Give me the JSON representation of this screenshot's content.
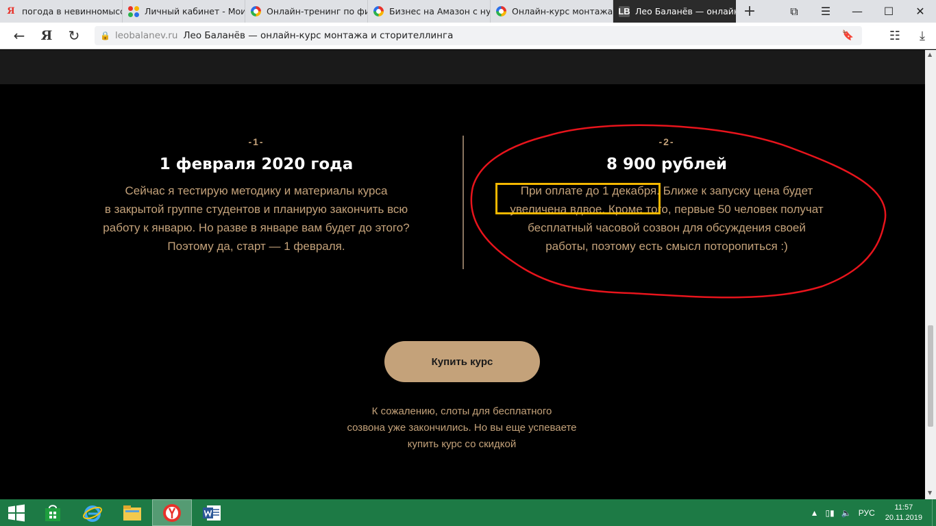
{
  "browser": {
    "tabs": [
      {
        "title": "погода в невинномысс",
        "icon": "yandex-icon",
        "active": false
      },
      {
        "title": "Личный кабинет - Мои",
        "icon": "grid-icon",
        "active": false
      },
      {
        "title": "Онлайн-тренинг по фи",
        "icon": "ring-icon",
        "active": false
      },
      {
        "title": "Бизнес на Амазон с ну",
        "icon": "ring-icon",
        "active": false
      },
      {
        "title": "Онлайн-курс монтажа",
        "icon": "ring-icon",
        "active": false
      },
      {
        "title": "Лео Баланёв — онлайн",
        "icon": "lb-icon",
        "active": true
      }
    ],
    "favicon_lb": "LB",
    "favicon_ya": "Я",
    "new_tab": "+",
    "address": {
      "domain": "leobalanev.ru",
      "title": "Лео Баланёв — онлайн-курс монтажа и сторителлинга"
    },
    "ya_button": "Я"
  },
  "content": {
    "step1": {
      "number": "-1-",
      "heading": "1 февраля 2020 года",
      "lines": [
        "Сейчас я тестирую методику и материалы курса",
        "в закрытой группе студентов и планирую закончить всю",
        "работу к январю. Но разве в январе вам будет до этого?",
        "Поэтому да, старт — 1 февраля."
      ]
    },
    "step2": {
      "number": "-2-",
      "heading": "8 900 рублей",
      "lines": [
        "При оплате до 1 декабря. Ближе к запуску цена будет",
        "увеличена вдвое. Кроме того, первые 50 человек получат",
        "бесплатный часовой созвон для обсуждения своей",
        "работы, поэтому есть смысл поторопиться :)"
      ]
    },
    "buy_button": "Купить курс",
    "note_lines": [
      "К сожалению, слоты для бесплатного",
      "созвона уже закончились. Но вы еще успеваете",
      "купить курс со скидкой"
    ],
    "colors": {
      "accent": "#c4a27a",
      "highlight_box": "#f5b800",
      "annotation": "#e8141c"
    }
  },
  "taskbar": {
    "apps": [
      "windows-start-icon",
      "store-icon",
      "internet-explorer-icon",
      "file-explorer-icon",
      "yandex-browser-icon",
      "word-icon"
    ],
    "language": "РУС",
    "time": "11:57",
    "date": "20.11.2019"
  }
}
